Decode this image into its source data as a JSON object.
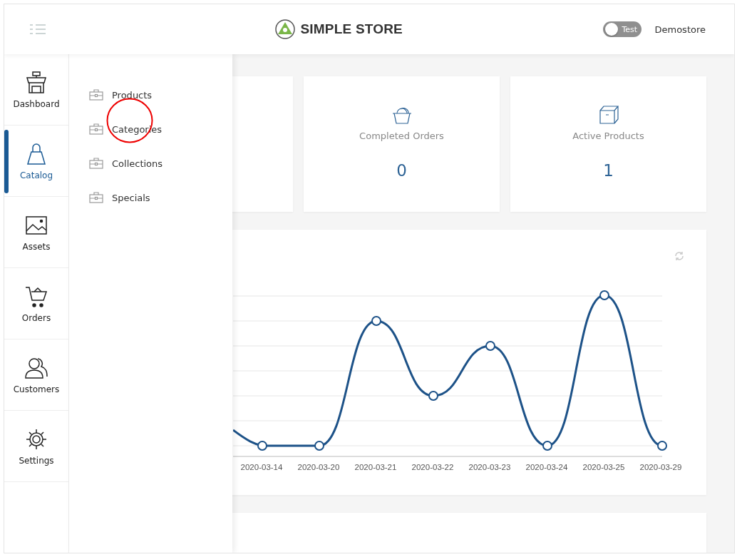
{
  "header": {
    "logo_text": "SIMPLE STORE",
    "test_toggle": {
      "label": "Test",
      "on": false
    },
    "store_name": "Demostore"
  },
  "sidebar": {
    "items": [
      {
        "label": "Dashboard",
        "kind": "dashboard",
        "selected": false
      },
      {
        "label": "Catalog",
        "kind": "catalog",
        "selected": true
      },
      {
        "label": "Assets",
        "kind": "assets",
        "selected": false
      },
      {
        "label": "Orders",
        "kind": "orders",
        "selected": false
      },
      {
        "label": "Customers",
        "kind": "customers",
        "selected": false
      },
      {
        "label": "Settings",
        "kind": "settings",
        "selected": false
      }
    ]
  },
  "submenu": {
    "items": [
      "Products",
      "Categories",
      "Collections",
      "Specials"
    ]
  },
  "stat_cards": [
    {
      "kind": "orders",
      "label": "Completed Orders",
      "value": "0"
    },
    {
      "kind": "products",
      "label": "Active Products",
      "value": "1"
    }
  ],
  "chart": {
    "x_labels": [
      "2020-03-14",
      "2020-03-20",
      "2020-03-21",
      "2020-03-22",
      "2020-03-23",
      "2020-03-24",
      "2020-03-25",
      "2020-03-29"
    ]
  }
}
